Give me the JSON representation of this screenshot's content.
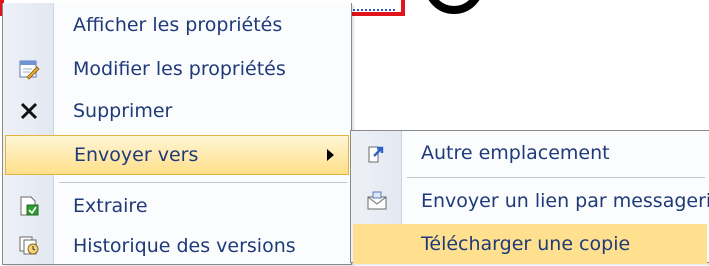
{
  "main_menu": {
    "items": [
      {
        "label": "Afficher les propriétés",
        "icon": "view-properties-icon"
      },
      {
        "label": "Modifier les propriétés",
        "icon": "edit-properties-icon"
      },
      {
        "label": "Supprimer",
        "icon": "delete-x-icon"
      },
      {
        "label": "Envoyer vers",
        "icon": "submenu-arrow-icon"
      },
      {
        "label": "Extraire",
        "icon": "check-out-icon"
      },
      {
        "label": "Historique des versions",
        "icon": "version-history-icon"
      }
    ]
  },
  "sub_menu": {
    "items": [
      {
        "label": "Autre emplacement",
        "icon": "send-to-location-icon"
      },
      {
        "label": "Envoyer un lien par messagerie",
        "icon": "email-link-icon"
      },
      {
        "label": "Télécharger une copie",
        "icon": ""
      }
    ]
  },
  "colors": {
    "highlight": "#ffdf89",
    "label_text": "#1f3a78",
    "top_border": "#e0141a"
  }
}
